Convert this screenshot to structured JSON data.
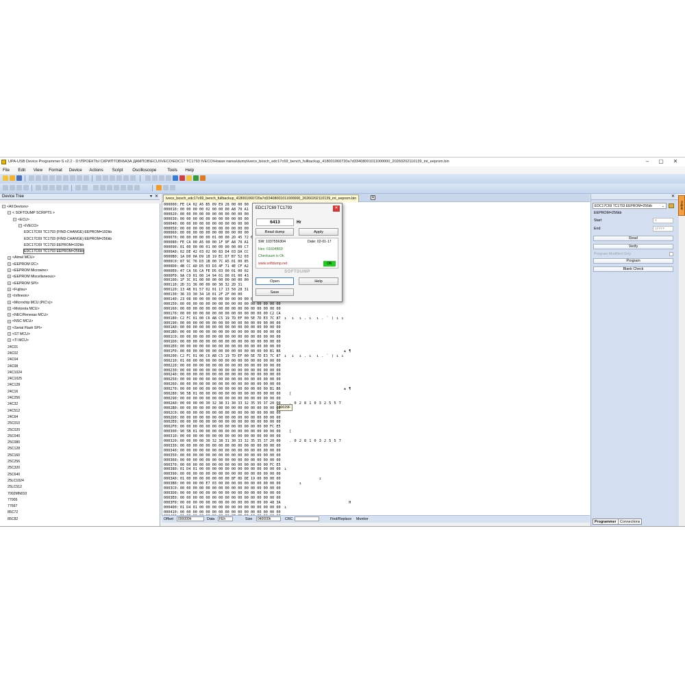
{
  "window": {
    "title": "UPA-USB Device Programmer-S v2.2 - D:\\ПРОЕКТЫ СКРИПТОВ\\БАЗА ДАМПОВ\\ECU\\IVECO\\EDC17 TC1793 IVECO\\Новая папка\\dump\\iveco_bosch_edc17c69_bench_fullbackup_418001060720a7d33408001011000000_20260202110139_int_eeprom.bin",
    "minimize": "–",
    "maximize": "▢",
    "close": "✕"
  },
  "menu": [
    "File",
    "Edit",
    "View",
    "Format",
    "Device",
    "Actions",
    "Script",
    "Oscilloscope",
    "Tools",
    "Help"
  ],
  "device_tree": {
    "header": "Device Tree",
    "pin": "▾",
    "close": "✕",
    "rows": [
      {
        "label": "<All Devices>",
        "indent": 0,
        "exp": "−"
      },
      {
        "label": "< SOFTDUMP SCRIPTS >",
        "indent": 1,
        "exp": "−"
      },
      {
        "label": "<ECU>",
        "indent": 2,
        "exp": "−"
      },
      {
        "label": "<IVECO>",
        "indent": 3,
        "exp": "−"
      },
      {
        "label": "EDC17C69 TC1793 (FIND-CHANGE) EEPROM=192kb",
        "indent": 4,
        "exp": ""
      },
      {
        "label": "EDC17C69 TC1793 (FIND-CHANGE) EEPROM=256kb",
        "indent": 4,
        "exp": ""
      },
      {
        "label": "EDC17C69 TC1793 EEPROM=192kb",
        "indent": 4,
        "exp": ""
      },
      {
        "label": "EDC17C69 TC1793 EEPROM=256kb",
        "indent": 4,
        "exp": "",
        "selected": true
      },
      {
        "label": "<Atmel MCU>",
        "indent": 1,
        "exp": "+"
      },
      {
        "label": "<EEPROM I2C>",
        "indent": 1,
        "exp": "+"
      },
      {
        "label": "<EEPROM Microwire>",
        "indent": 1,
        "exp": "+"
      },
      {
        "label": "<EEPROM Miscellaneous>",
        "indent": 1,
        "exp": "+"
      },
      {
        "label": "<EEPROM SPI>",
        "indent": 1,
        "exp": "+"
      },
      {
        "label": "<Fujitsu>",
        "indent": 1,
        "exp": "+"
      },
      {
        "label": "<Infineon>",
        "indent": 1,
        "exp": "+"
      },
      {
        "label": "<Microchip MCU (PIC's)>",
        "indent": 1,
        "exp": "+"
      },
      {
        "label": "<Motorola MCU>",
        "indent": 1,
        "exp": "+"
      },
      {
        "label": "<NEC/Renesas MCU>",
        "indent": 1,
        "exp": "+"
      },
      {
        "label": "<NSC MCU>",
        "indent": 1,
        "exp": "+"
      },
      {
        "label": "<Serial Flash SPI>",
        "indent": 1,
        "exp": "+"
      },
      {
        "label": "<ST MCU>",
        "indent": 1,
        "exp": "+"
      },
      {
        "label": "<TI MCU>",
        "indent": 1,
        "exp": "+"
      },
      {
        "label": "24C01",
        "indent": 1,
        "exp": ""
      },
      {
        "label": "24C02",
        "indent": 1,
        "exp": ""
      },
      {
        "label": "24C04",
        "indent": 1,
        "exp": ""
      },
      {
        "label": "24C08",
        "indent": 1,
        "exp": ""
      },
      {
        "label": "24C1024",
        "indent": 1,
        "exp": ""
      },
      {
        "label": "24C1025",
        "indent": 1,
        "exp": ""
      },
      {
        "label": "24C128",
        "indent": 1,
        "exp": ""
      },
      {
        "label": "24C16",
        "indent": 1,
        "exp": ""
      },
      {
        "label": "24C256",
        "indent": 1,
        "exp": ""
      },
      {
        "label": "24C32",
        "indent": 1,
        "exp": ""
      },
      {
        "label": "24C512",
        "indent": 1,
        "exp": ""
      },
      {
        "label": "24C64",
        "indent": 1,
        "exp": ""
      },
      {
        "label": "25C010",
        "indent": 1,
        "exp": ""
      },
      {
        "label": "25C020",
        "indent": 1,
        "exp": ""
      },
      {
        "label": "25C040",
        "indent": 1,
        "exp": ""
      },
      {
        "label": "25C080",
        "indent": 1,
        "exp": ""
      },
      {
        "label": "25C128",
        "indent": 1,
        "exp": ""
      },
      {
        "label": "25C160",
        "indent": 1,
        "exp": ""
      },
      {
        "label": "25C256",
        "indent": 1,
        "exp": ""
      },
      {
        "label": "25C320",
        "indent": 1,
        "exp": ""
      },
      {
        "label": "25C640",
        "indent": 1,
        "exp": ""
      },
      {
        "label": "25LC1024",
        "indent": 1,
        "exp": ""
      },
      {
        "label": "25LC512",
        "indent": 1,
        "exp": ""
      },
      {
        "label": "7002MN010",
        "indent": 1,
        "exp": ""
      },
      {
        "label": "77005",
        "indent": 1,
        "exp": ""
      },
      {
        "label": "77667",
        "indent": 1,
        "exp": ""
      },
      {
        "label": "85C72",
        "indent": 1,
        "exp": ""
      },
      {
        "label": "85C82",
        "indent": 1,
        "exp": ""
      }
    ]
  },
  "editor": {
    "tab_label": "iveco_bosch_edc17c69_bench_fullbackup_418001060720a7d33408001011000000_20260202110139_int_eeprom.bin",
    "tab_close": "✕",
    "tooltip": "00029F",
    "rows": [
      {
        "off": "000000:",
        "hex": "FE CA 02 A5 B5 09 E9 28 00 00 00",
        "asc": ""
      },
      {
        "off": "000010:",
        "hex": "00 00 00 00 02 00 00 00 A8 70 A1",
        "asc": ""
      },
      {
        "off": "000020:",
        "hex": "00 00 00 00 00 00 00 00 00 00 00",
        "asc": ""
      },
      {
        "off": "000030:",
        "hex": "00 00 00 00 00 00 00 00 00 00 00",
        "asc": ""
      },
      {
        "off": "000040:",
        "hex": "00 00 00 00 00 00 00 00 00 00 00",
        "asc": ""
      },
      {
        "off": "000050:",
        "hex": "00 00 00 00 00 00 00 00 00 00 00",
        "asc": ""
      },
      {
        "off": "000060:",
        "hex": "00 00 00 00 00 00 00 00 00 00 00",
        "asc": ""
      },
      {
        "off": "000070:",
        "hex": "00 00 00 00 00 01 00 00 2D 45 72 61",
        "asc": "   0 ı"
      },
      {
        "off": "000080:",
        "hex": "FE CA 00 A5 00 00 1F 9F A8 70 A1",
        "asc": "   ı"
      },
      {
        "off": "000090:",
        "hex": "01 00 00 00 01 00 00 00 00 00 C7",
        "asc": "    ı"
      },
      {
        "off": "0000A0:",
        "hex": "02 DE 42 03 02 00 83 D4 03 DA CC",
        "asc": "   ı"
      },
      {
        "off": "0000B0:",
        "hex": "1A D0 0A D9 18 19 EC D7 B7 52 03",
        "asc": "   ı"
      },
      {
        "off": "0000C0:",
        "hex": "87 9C 76 D3 1B 00 7C A5 01 00 85",
        "asc": "   ı"
      },
      {
        "off": "0000D0:",
        "hex": "4B CC A0 D5 03 D3 4F 71 4E CF A2",
        "asc": "   ı"
      },
      {
        "off": "0000E0:",
        "hex": "47 CA 56 CA FE D5 03 00 01 00 02",
        "asc": "   ı"
      },
      {
        "off": "0000F0:",
        "hex": "9A C9 01 00 14 94 01 00 01 00 43",
        "asc": "   7"
      },
      {
        "off": "000100:",
        "hex": "1F 3C 01 00 00 00 00 00 00 00 00",
        "asc": "   1 2"
      },
      {
        "off": "000110:",
        "hex": "2D 31 36 00 00 00 30 32 2D 31",
        "asc": "   X"
      },
      {
        "off": "000120:",
        "hex": "13 48 01 57 02 01 17 13 50 28 31",
        "asc": "   5 5"
      },
      {
        "off": "000130:",
        "hex": "36 33 30 34 10 01 2F 2F 00 00",
        "asc": "   ı"
      },
      {
        "off": "000140:",
        "hex": "23 08 00 00 00 00 00 00 00 00 00 00 00 00 00 00",
        "asc": ""
      },
      {
        "off": "000150:",
        "hex": "00 00 00 00 00 00 00 00 00 00 00 00 00 00 00 00",
        "asc": ""
      },
      {
        "off": "000160:",
        "hex": "00 00 00 00 00 00 00 00 00 00 00 00 00 00 00 00",
        "asc": ""
      },
      {
        "off": "000170:",
        "hex": "00 00 00 00 00 00 00 00 00 00 00 00 00 00 C2 CA",
        "asc": ""
      },
      {
        "off": "000180:",
        "hex": "C2 FC 01 00 C6 AB C5 19 7D EF 00 5E 7D E3 7C 87",
        "asc": "ı  ı  ı . ı  ı . ` ) ı ı"
      },
      {
        "off": "000190:",
        "hex": "00 00 00 00 00 00 00 00 00 00 00 00 00 00 00 00",
        "asc": ""
      },
      {
        "off": "0001A0:",
        "hex": "00 00 00 00 00 00 00 00 00 00 00 00 00 00 00 00",
        "asc": ""
      },
      {
        "off": "0001B0:",
        "hex": "00 00 00 00 00 00 00 00 00 00 00 00 00 00 00 00",
        "asc": ""
      },
      {
        "off": "0001C0:",
        "hex": "00 00 00 00 00 00 00 00 00 00 00 00 00 00 00 00",
        "asc": ""
      },
      {
        "off": "0001D0:",
        "hex": "00 00 00 00 00 00 00 00 00 00 00 00 00 00 00 00",
        "asc": ""
      },
      {
        "off": "0001E0:",
        "hex": "00 00 00 00 00 00 00 00 00 00 00 00 00 00 00 00",
        "asc": ""
      },
      {
        "off": "0001F0:",
        "hex": "00 00 00 00 00 00 00 00 00 00 00 00 00 00 B1 B6",
        "asc": "                        ± ¶"
      },
      {
        "off": "000200:",
        "hex": "C2 FC 01 00 C6 AB C5 19 7D EF 00 5E 7D E3 7C 87",
        "asc": "ı  ı  ı . ı  ı . ` ) ı ı"
      },
      {
        "off": "000210:",
        "hex": "01 00 00 00 00 00 00 00 00 00 00 00 00 00 00 00",
        "asc": ""
      },
      {
        "off": "000220:",
        "hex": "00 00 00 00 00 00 00 00 00 00 00 00 00 00 00 00",
        "asc": ""
      },
      {
        "off": "000230:",
        "hex": "00 00 00 00 00 00 00 00 00 00 00 00 00 00 00 00",
        "asc": ""
      },
      {
        "off": "000240:",
        "hex": "00 00 00 00 00 00 00 00 00 00 00 00 00 00 00 00",
        "asc": ""
      },
      {
        "off": "000250:",
        "hex": "00 00 00 00 00 00 00 00 00 00 00 00 00 00 00 00",
        "asc": ""
      },
      {
        "off": "000260:",
        "hex": "00 00 00 00 00 00 00 00 00 00 00 00 00 00 00 00",
        "asc": ""
      },
      {
        "off": "000270:",
        "hex": "00 00 00 00 00 00 00 00 00 00 00 00 00 00 B1 B6",
        "asc": "                        ± ¶"
      },
      {
        "off": "000280:",
        "hex": "90 5B 01 00 00 00 00 00 00 00 00 00 00 00 00 00",
        "asc": "  ["
      },
      {
        "off": "000290:",
        "hex": "00 00 00 00 00 00 00 00 00 00 00 00 00 00 00 00",
        "asc": ""
      },
      {
        "off": "0002A0:",
        "hex": "00 00 00 00 30 32 38 31 30 33 32 35 35 37 20 00",
        "asc": "  . 0 2 8 1 0 3 2 5 5 7"
      },
      {
        "off": "0002B0:",
        "hex": "00 00 00 00 00 00 00 00 00 00 00 00 00 00 00 00",
        "asc": ""
      },
      {
        "off": "0002C0:",
        "hex": "00 00 00 00 00 00 00 00 00 00 00 00 00 00 00 00",
        "asc": ""
      },
      {
        "off": "0002D0:",
        "hex": "00 00 00 00 00 00 00 00 00 00 00 00 00 00 00 00",
        "asc": ""
      },
      {
        "off": "0002E0:",
        "hex": "00 00 00 00 00 00 00 00 00 00 00 00 00 00 00 00",
        "asc": ""
      },
      {
        "off": "0002F0:",
        "hex": "00 00 00 00 00 00 00 00 00 00 00 00 00 00 FC E5",
        "asc": ""
      },
      {
        "off": "000300:",
        "hex": "90 5B 01 00 00 00 00 00 00 00 00 00 00 00 00 00",
        "asc": "  ["
      },
      {
        "off": "000310:",
        "hex": "00 00 00 00 00 00 00 00 00 00 00 00 00 00 00 00",
        "asc": ""
      },
      {
        "off": "000320:",
        "hex": "00 00 00 00 30 32 38 31 30 33 32 35 35 37 20 00",
        "asc": "  . 0 2 8 1 0 3 2 5 5 7"
      },
      {
        "off": "000330:",
        "hex": "00 00 00 00 00 00 00 00 00 00 00 00 00 00 00 00",
        "asc": ""
      },
      {
        "off": "000340:",
        "hex": "00 00 00 00 00 00 00 00 00 00 00 00 00 00 00 00",
        "asc": ""
      },
      {
        "off": "000350:",
        "hex": "00 00 00 00 00 00 00 00 00 00 00 00 00 00 00 00",
        "asc": ""
      },
      {
        "off": "000360:",
        "hex": "00 00 00 00 00 00 00 00 00 00 00 00 00 00 00 00",
        "asc": ""
      },
      {
        "off": "000370:",
        "hex": "00 00 00 00 00 00 00 00 00 00 00 00 00 00 FC E5",
        "asc": ""
      },
      {
        "off": "000380:",
        "hex": "01 D4 01 00 00 00 00 00 00 00 00 00 00 00 00 00",
        "asc": "ı"
      },
      {
        "off": "000390:",
        "hex": "00 00 00 00 00 00 00 00 00 00 00 00 00 00 00 00",
        "asc": ""
      },
      {
        "off": "0003A0:",
        "hex": "01 00 00 00 00 00 00 00 8F 0D DE 19 00 00 00 00",
        "asc": "              ı"
      },
      {
        "off": "0003B0:",
        "hex": "00 00 00 00 E7 03 00 00 00 00 00 00 00 00 00 00",
        "asc": "      ı"
      },
      {
        "off": "0003C0:",
        "hex": "00 00 00 00 00 00 00 00 00 00 00 00 00 00 00 00",
        "asc": ""
      },
      {
        "off": "0003D0:",
        "hex": "00 00 00 00 00 00 00 00 00 00 00 00 00 00 00 00",
        "asc": ""
      },
      {
        "off": "0003E0:",
        "hex": "00 00 00 00 00 00 00 00 00 00 00 00 00 00 00 00",
        "asc": ""
      },
      {
        "off": "0003F0:",
        "hex": "00 00 00 00 00 00 00 00 00 00 00 00 00 00 48 3A",
        "asc": "                          H"
      },
      {
        "off": "000400:",
        "hex": "01 D4 01 00 00 00 00 00 00 00 00 00 00 00 00 00",
        "asc": "ı"
      },
      {
        "off": "000410:",
        "hex": "00 00 00 00 00 00 00 00 00 00 00 00 00 00 00 00",
        "asc": ""
      },
      {
        "off": "000420:",
        "hex": "01 00 00 00 00 00 00 00 8F 0D DE 19 00 00 00 00",
        "asc": "              ı"
      }
    ]
  },
  "status": {
    "offset_label": "Offset",
    "offset_value": "000000h",
    "data_label": "Data",
    "data_value": "FEh",
    "size_label": "Size",
    "size_value": "040000h",
    "crc_label": "CRC",
    "crc_value": "",
    "find_replace": "Find/Replace",
    "monitor": "Monitor"
  },
  "right_panel": {
    "header_close": "✕",
    "device_select": "EDC17C69 TC1793 EEPROM=256kb",
    "device_info": "EEPROM=256kb",
    "start_label": "Start",
    "start_value": "0",
    "end_label": "End",
    "end_value": "1FFFF",
    "read_button": "Read",
    "verify_button": "Verify",
    "modified_only": "Program Modified Only",
    "program_button": "Program",
    "blank_check_button": "Blank Check",
    "tabs": [
      "Programmer",
      "Connections"
    ],
    "side_tab": "Output"
  },
  "dialog": {
    "title": "EDC17C69 TC1793",
    "close": "✕",
    "hours_value": "6413",
    "hours_unit": "Hr",
    "read_dump_button": "Read dump",
    "apply_button": "Apply",
    "sw_label": "SW: 1037556304",
    "date_label": "Date: 02-01-17",
    "hex_label": "Hex: 01604B69",
    "checksum_label": "Checksum is Ok",
    "website": "www.softdump.net",
    "ok_badge": "OK",
    "brand": "SOFTDUMP",
    "open_button": "Open",
    "help_button": "Help",
    "save_button": "Save",
    "colors": {
      "hex": "#1d7c1d",
      "checksum": "#1d7c1d",
      "website": "#b01818",
      "ok": "#22cc22"
    }
  }
}
